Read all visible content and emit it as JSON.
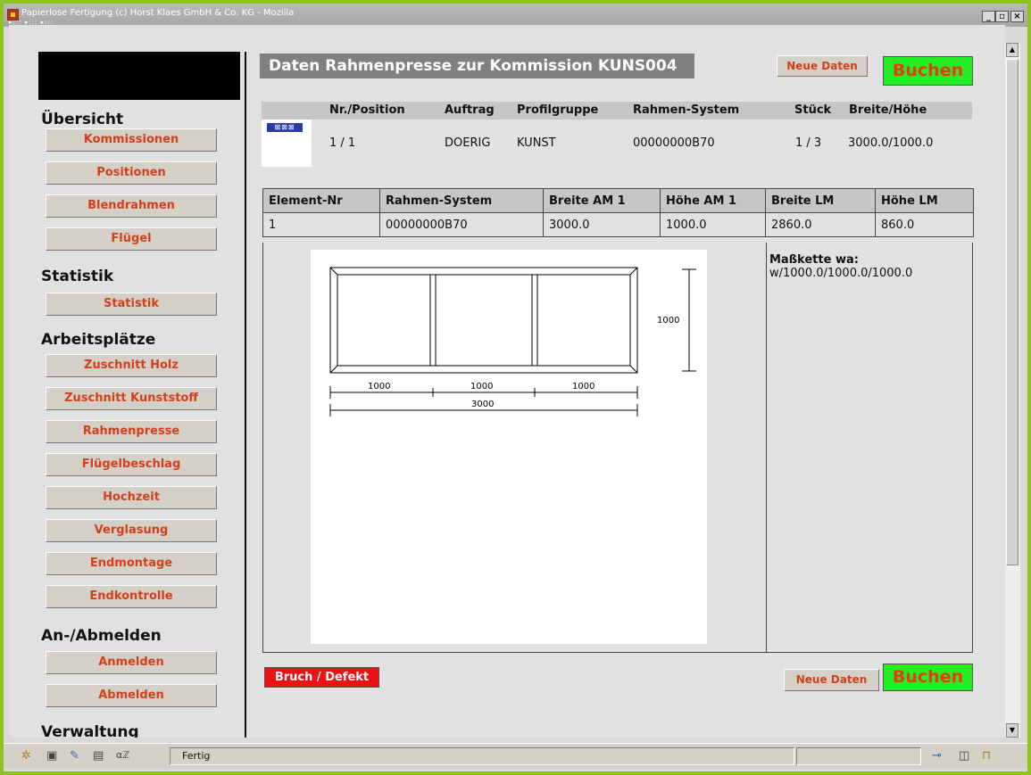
{
  "window": {
    "title": "Papierlose Fertigung (c) Horst Klaes GmbH & Co. KG - Mozilla",
    "tabs": "▸::: ▸::: ▸:::",
    "minimize": "_",
    "restore": "▫",
    "close": "×"
  },
  "sidebar": {
    "sections": [
      {
        "title": "Übersicht",
        "items": [
          "Kommissionen",
          "Positionen",
          "Blendrahmen",
          "Flügel"
        ]
      },
      {
        "title": "Statistik",
        "items": [
          "Statistik"
        ]
      },
      {
        "title": "Arbeitsplätze",
        "items": [
          "Zuschnitt Holz",
          "Zuschnitt Kunststoff",
          "Rahmenpresse",
          "Flügelbeschlag",
          "Hochzeit",
          "Verglasung",
          "Endmontage",
          "Endkontrolle"
        ]
      },
      {
        "title": "An-/Abmelden",
        "items": [
          "Anmelden",
          "Abmelden"
        ]
      },
      {
        "title": "Verwaltung",
        "items": []
      }
    ]
  },
  "main": {
    "title": "Daten Rahmenpresse zur Kommission KUNS004",
    "neue_daten": "Neue Daten",
    "buchen": "Buchen",
    "position": {
      "headers": [
        "Nr./Position",
        "Auftrag",
        "Profilgruppe",
        "Rahmen-System",
        "Stück",
        "Breite/Höhe"
      ],
      "row": [
        "1 / 1",
        "DOERIG",
        "KUNST",
        "00000000B70",
        "1 / 3",
        "3000.0/1000.0"
      ],
      "thumb_icons": "⊠⊠⊠"
    },
    "element_table": {
      "headers": [
        "Element-Nr",
        "Rahmen-System",
        "Breite AM 1",
        "Höhe AM 1",
        "Breite LM",
        "Höhe LM"
      ],
      "rows": [
        [
          "1",
          "00000000B70",
          "3000.0",
          "1000.0",
          "2860.0",
          "860.0"
        ]
      ]
    },
    "drawing": {
      "width_segments": [
        "1000",
        "1000",
        "1000"
      ],
      "total_width": "3000",
      "height": "1000"
    },
    "masskette": {
      "label": "Maßkette wa:",
      "value": "w/1000.0/1000.0/1000.0"
    },
    "bruch": "Bruch / Defekt"
  },
  "statusbar": {
    "text": "Fertig"
  }
}
